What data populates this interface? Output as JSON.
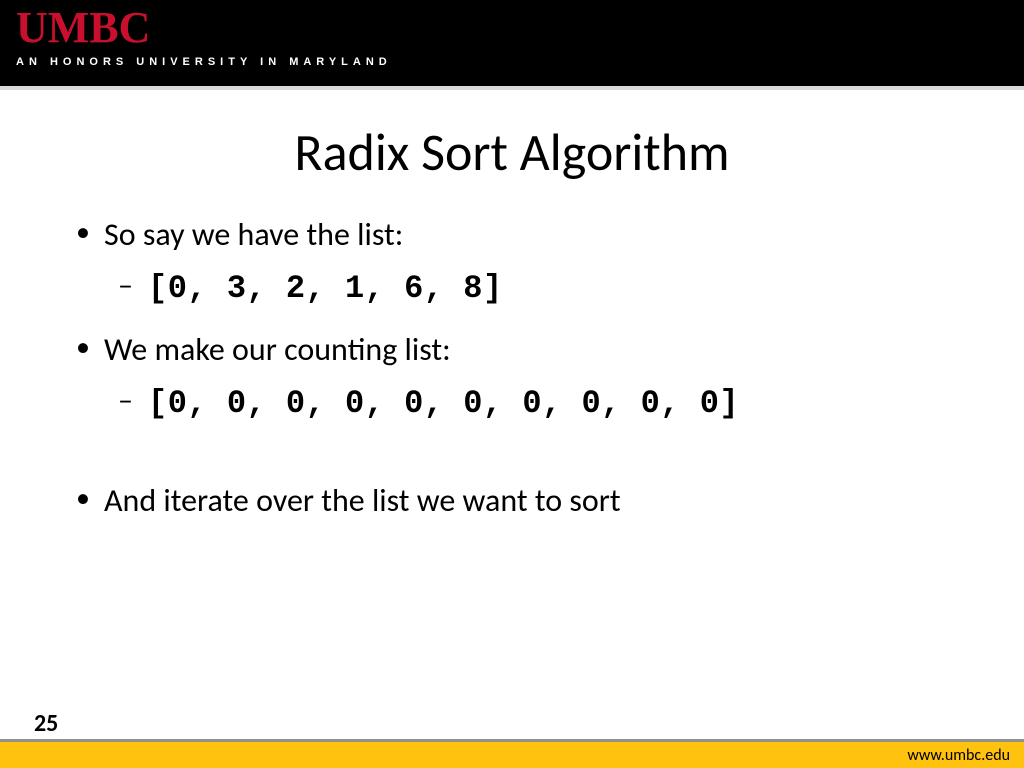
{
  "header": {
    "logo": "UMBC",
    "tagline": "AN HONORS UNIVERSITY IN MARYLAND"
  },
  "title": "Radix Sort Algorithm",
  "bullets": {
    "b1": "So say we have the list:",
    "b1_code": "[0, 3, 2, 1, 6, 8]",
    "b2": "We make our counting list:",
    "b2_code": "[0, 0, 0, 0, 0, 0, 0, 0, 0, 0]",
    "b3": "And iterate over the list we want to sort"
  },
  "footer": {
    "page": "25",
    "url": "www.umbc.edu"
  }
}
